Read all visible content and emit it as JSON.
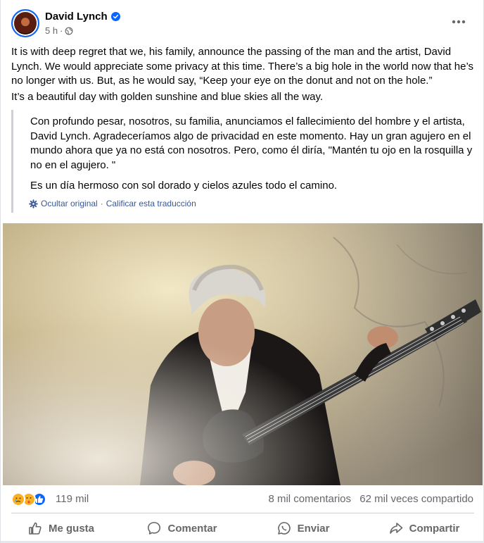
{
  "post": {
    "author": "David Lynch",
    "time": "5 h",
    "dot": "·",
    "paragraphs": [
      "It is with deep regret that we, his family, announce the passing of the man and the artist, David Lynch.  We would appreciate some privacy at this time.  There’s a big hole in the world now that he’s no longer with us.  But, as he would say, “Keep your eye on the donut and not on the hole.”",
      "It’s a beautiful day with golden sunshine and blue skies all the way."
    ],
    "translation": {
      "paragraphs": [
        "Con profundo pesar, nosotros, su familia, anunciamos el fallecimiento del hombre y el artista, David Lynch. Agradeceríamos algo de privacidad en este momento. Hay un gran agujero en el mundo ahora que ya no está con nosotros. Pero, como él diría, \"Mantén tu ojo en la rosquilla y no en el agujero. \"",
        "Es un día hermoso con sol dorado y cielos azules todo el camino."
      ],
      "hide_original": "Ocultar original",
      "separator": "·",
      "rate_translation": "Calificar esta traducción"
    }
  },
  "stats": {
    "reactions": "119 mil",
    "comments": "8 mil comentarios",
    "shares": "62 mil veces compartido"
  },
  "actions": {
    "like": "Me gusta",
    "comment": "Comentar",
    "send": "Enviar",
    "share": "Compartir"
  },
  "icons": {
    "verified": "verified-badge-icon",
    "privacy": "globe-icon",
    "more": "more-horizontal-icon",
    "translate": "gear-icon",
    "reactions": [
      "sad-reaction-icon",
      "care-reaction-icon",
      "like-reaction-icon"
    ]
  },
  "colors": {
    "accent": "#0866ff",
    "secondary_text": "#65676b",
    "link": "#385898"
  }
}
